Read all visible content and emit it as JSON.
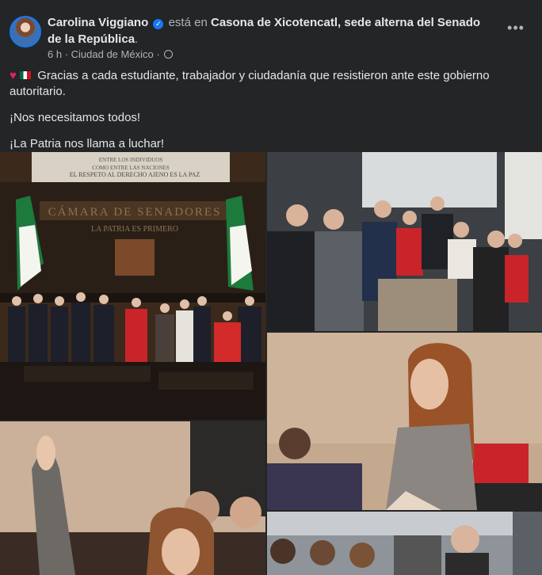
{
  "post": {
    "author": "Carolina Viggiano",
    "checkin_text": "está en",
    "place": "Casona de Xicotencatl, sede alterna del Senado de la República",
    "time": "6 h",
    "location": "Ciudad de México",
    "more_icon": "more-options-icon",
    "paragraphs": [
      "Gracias a cada estudiante, trabajador y ciudadanía que resistieron ante este gobierno autoritario.",
      "¡Nos necesitamos todos!",
      "¡La Patria nos llama a luchar!"
    ],
    "emoji": [
      "heart-emoji",
      "mexico-flag-emoji"
    ]
  },
  "photos": {
    "p1_inscription_1": "CÁMARA DE SENADORES",
    "p1_inscription_2": "LA PATRIA ES PRIMERO",
    "p1_inscription_3": "EL RESPETO AL DERECHO AJENO ES LA PAZ"
  },
  "colors": {
    "background": "#242526",
    "text": "#e4e6eb",
    "muted": "#b0b3b8",
    "verified": "#1877f2"
  }
}
